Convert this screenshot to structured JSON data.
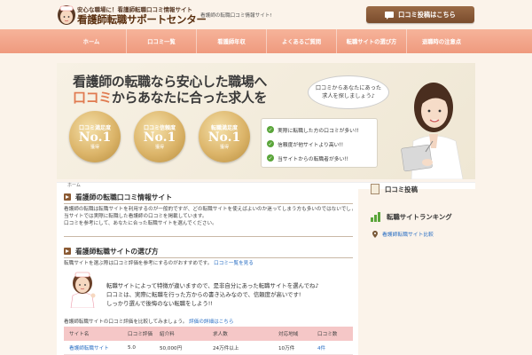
{
  "header": {
    "logo_sub": "安心な職場に！看護師転職口コミ情報サイト",
    "logo_main": "看護師転職サポートセンター",
    "tagline": "看護師の転職口コミ情報サイト!",
    "post_button": "口コミ投稿はこちら"
  },
  "nav": [
    "ホーム",
    "口コミ一覧",
    "看護師年収",
    "よくあるご質問",
    "転職サイトの選び方",
    "退職時の注意点"
  ],
  "hero": {
    "line1": "看護師の転職なら安心した職場へ",
    "line2_accent": "口コミ",
    "line2_rest": "からあなたに合った求人を",
    "bubble_line1": "口コミからあなたにあった",
    "bubble_line2": "求人を探しましょう♪",
    "medals": [
      {
        "title": "口コミ満足度",
        "rank": "No.1",
        "foot": "獲得"
      },
      {
        "title": "口コミ信頼度",
        "rank": "No.1",
        "foot": "獲得"
      },
      {
        "title": "転職満足度",
        "rank": "No.1",
        "foot": "獲得"
      }
    ],
    "features": [
      "実際に転職した方の口コミが多い!!",
      "信頼度が他サイトより高い!!",
      "当サイトからの転職者が多い!!"
    ]
  },
  "breadcrumb": "ホーム",
  "main": {
    "section1_title": "看護師の転職口コミ情報サイト",
    "section1_para_line1": "看護師の転職は転職サイトを利用するのが一般的ですが、どの転職サイトを使えばよいのか迷ってしまう方も多いのではないでしょうか。",
    "section1_para_line2": "当サイトでは実際に転職した看護師の口コミを掲載しています。",
    "section1_para_line3": "口コミを参考にして、あなたに合った転職サイトを選んでください。",
    "section2_title": "看護師転職サイトの選び方",
    "section2_text": "転職サイトを選ぶ際は口コミ評価を参考にするのがおすすめです。",
    "section2_link": "口コミ一覧を見る",
    "speech_line1": "転職サイトによって特徴が違いますので、是非自分にあった転職サイトを選んでね♪",
    "speech_line2": "口コミは、実際に転職を行った方からの書き込みなので、信頼度が高いです!",
    "speech_line3": "しっかり選んで後悔のない転職をしよう!!",
    "table_intro": "看護師転職サイトの口コミ評価を比較してみましょう。",
    "table_intro_link": "評価の詳細はこちら",
    "table_headers": [
      "サイト名",
      "口コミ評価",
      "紹介料",
      "求人数",
      "対応地域",
      "口コミ数"
    ],
    "table_rows": [
      [
        "看護師転職サイト",
        "5.0",
        "50,000円",
        "24万件以上",
        "10万件",
        "4件"
      ]
    ]
  },
  "sidebar": {
    "item1": "口コミ投稿",
    "item2": "転職サイトランキング",
    "link": "看護師転職サイト比較"
  }
}
